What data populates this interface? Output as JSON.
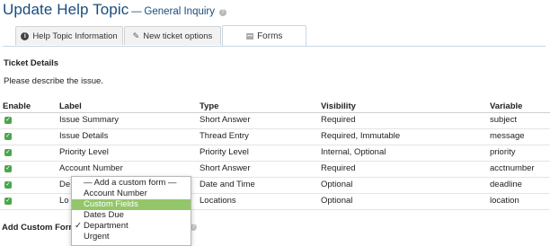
{
  "header": {
    "title": "Update Help Topic",
    "dash": "—",
    "subtitle": "General Inquiry",
    "help_icon": "question-circle-icon"
  },
  "tabs": [
    {
      "label": "Help Topic Information",
      "icon": "info-circle-icon",
      "active": false
    },
    {
      "label": "New ticket options",
      "icon": "magic-wand-icon",
      "active": false
    },
    {
      "label": "Forms",
      "icon": "forms-icon",
      "active": true
    }
  ],
  "section": {
    "title": "Ticket Details",
    "description": "Please describe the issue."
  },
  "table": {
    "columns": [
      "Enable",
      "Label",
      "Type",
      "Visibility",
      "Variable"
    ],
    "rows": [
      {
        "enabled": true,
        "label": "Issue Summary",
        "type": "Short Answer",
        "visibility": "Required",
        "variable": "subject"
      },
      {
        "enabled": true,
        "label": "Issue Details",
        "type": "Thread Entry",
        "visibility": "Required, Immutable",
        "variable": "message"
      },
      {
        "enabled": true,
        "label": "Priority Level",
        "type": "Priority Level",
        "visibility": "Internal, Optional",
        "variable": "priority"
      },
      {
        "enabled": true,
        "label": "Account Number",
        "type": "Short Answer",
        "visibility": "Required",
        "variable": "acctnumber"
      },
      {
        "enabled": true,
        "label": "De",
        "type": "Date and Time",
        "visibility": "Optional",
        "variable": "deadline"
      },
      {
        "enabled": true,
        "label": "Lo",
        "type": "Locations",
        "visibility": "Optional",
        "variable": "location"
      }
    ]
  },
  "add_form": {
    "label": "Add Custom Form",
    "label_visible": "Add Custom Form"
  },
  "dropdown": {
    "options": [
      {
        "label": "— Add a custom form —",
        "checked": false,
        "highlighted": false
      },
      {
        "label": "Account Number",
        "checked": false,
        "highlighted": false
      },
      {
        "label": "Custom Fields",
        "checked": false,
        "highlighted": true
      },
      {
        "label": "Dates Due",
        "checked": false,
        "highlighted": false
      },
      {
        "label": "Department",
        "checked": true,
        "highlighted": false
      },
      {
        "label": "Urgent",
        "checked": false,
        "highlighted": false
      }
    ]
  },
  "colors": {
    "title": "#1a4c7e",
    "enabled_check": "#4aa64a",
    "highlight": "#93c66b"
  }
}
